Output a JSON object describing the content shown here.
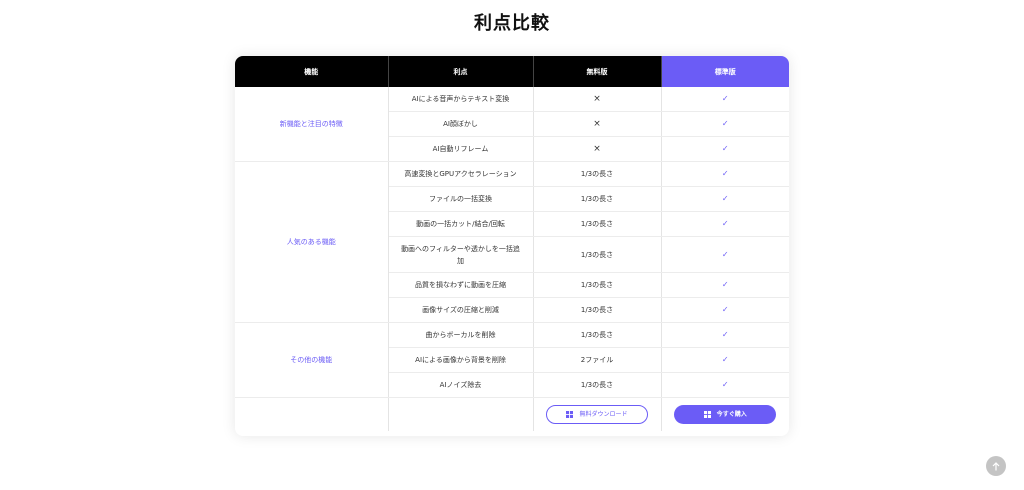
{
  "page": {
    "title": "利点比較"
  },
  "table": {
    "headers": [
      "機能",
      "利点",
      "無料版",
      "標準版"
    ],
    "categories": {
      "new": "新機能と注目の特徴",
      "popular": "人気のある機能",
      "other": "その他の機能"
    },
    "rows": [
      {
        "feature": "AIによる音声からテキスト変換",
        "free": "×",
        "standard": "✓"
      },
      {
        "feature": "AI顔ぼかし",
        "free": "×",
        "standard": "✓"
      },
      {
        "feature": "AI自動リフレーム",
        "free": "×",
        "standard": "✓"
      },
      {
        "feature": "高速変換とGPUアクセラレーション",
        "free": "1/3の長さ",
        "standard": "✓"
      },
      {
        "feature": "ファイルの一括変換",
        "free": "1/3の長さ",
        "standard": "✓"
      },
      {
        "feature": "動画の一括カット/結合/回転",
        "free": "1/3の長さ",
        "standard": "✓"
      },
      {
        "feature": "動画へのフィルターや透かしを一括追加",
        "free": "1/3の長さ",
        "standard": "✓"
      },
      {
        "feature": "品質を損なわずに動画を圧縮",
        "free": "1/3の長さ",
        "standard": "✓"
      },
      {
        "feature": "画像サイズの圧縮と削減",
        "free": "1/3の長さ",
        "standard": "✓"
      },
      {
        "feature": "曲からボーカルを削除",
        "free": "1/3の長さ",
        "standard": "✓"
      },
      {
        "feature": "AIによる画像から背景を削除",
        "free": "2ファイル",
        "standard": "✓"
      },
      {
        "feature": "AIノイズ除去",
        "free": "1/3の長さ",
        "standard": "✓"
      }
    ],
    "buttons": {
      "free_download": "無料ダウンロード",
      "buy_now": "今すぐ購入"
    }
  },
  "colors": {
    "accent": "#6b5cf6",
    "header_bg": "#000000"
  },
  "icons": {
    "button_icon": "windows-icon",
    "scroll": "arrow-up-icon"
  }
}
